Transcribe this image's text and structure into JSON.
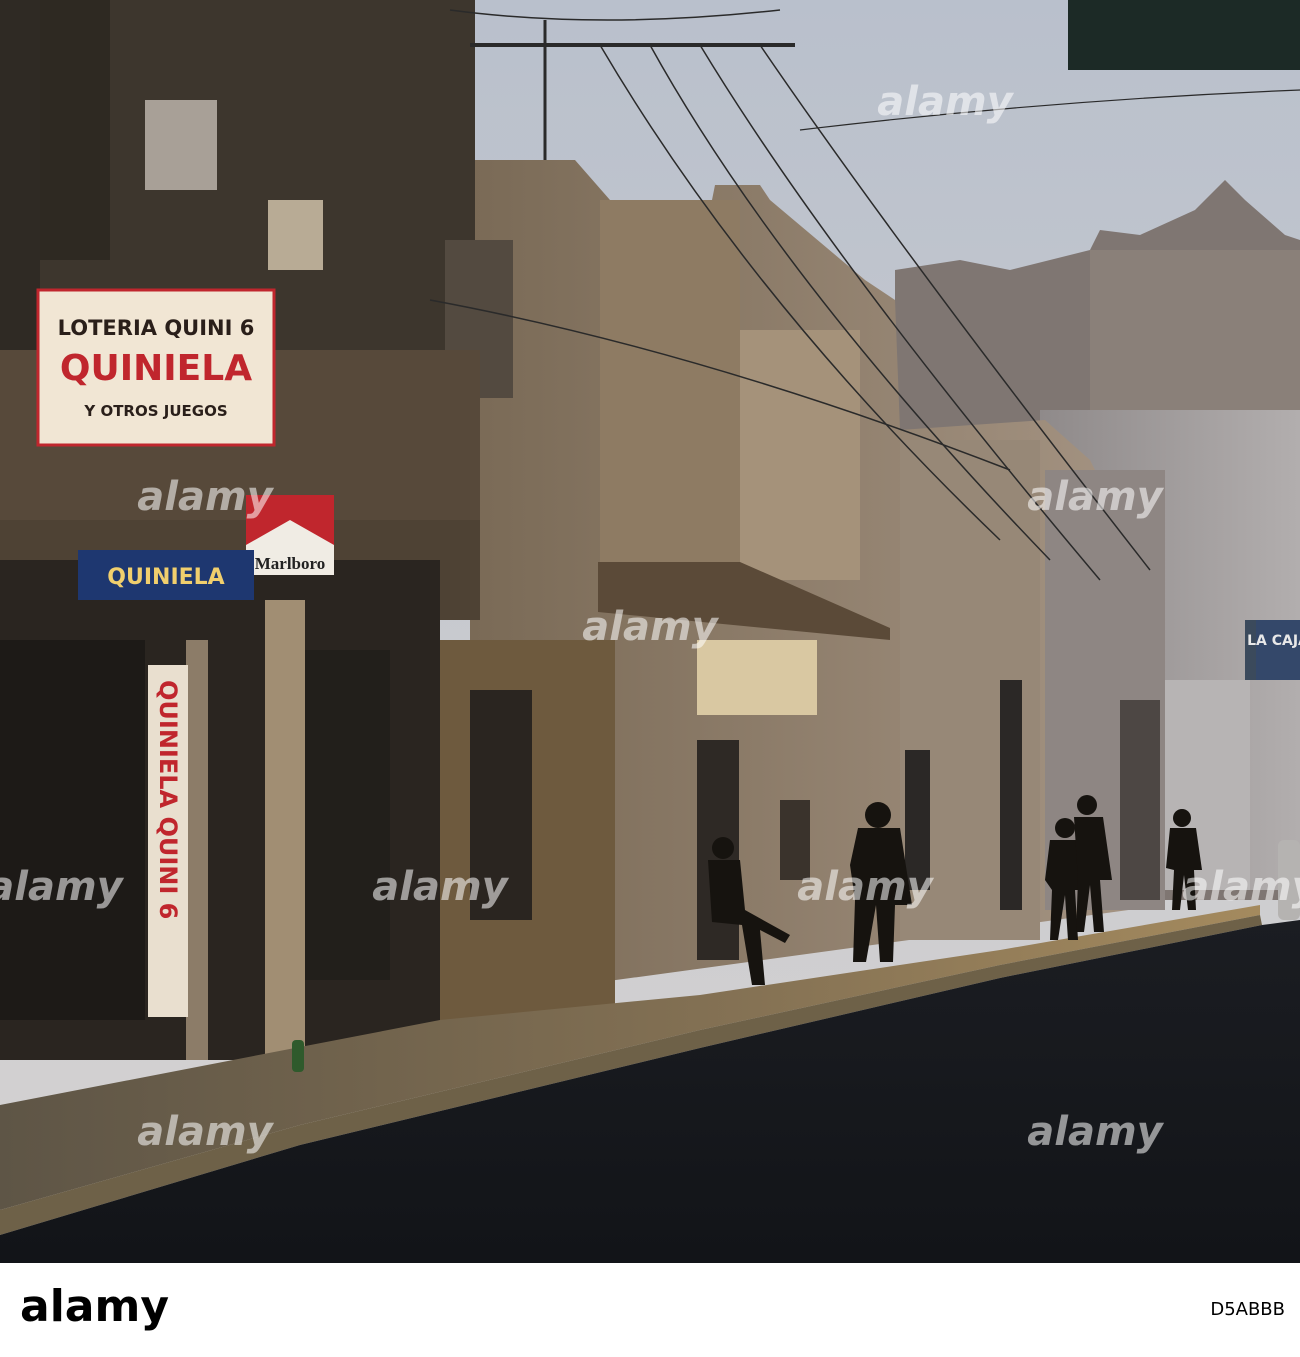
{
  "signs": {
    "loteria_line1": "LOTERIA QUINI 6",
    "loteria_line2": "QUINIELA",
    "loteria_line3": "Y OTROS JUEGOS",
    "quiniela_blue": "QUINIELA",
    "marlboro": "Marlboro",
    "vertical_quiniela": "QUINIELA QUINI 6",
    "la_caja": "LA CAJA"
  },
  "watermark": {
    "text": "alamy"
  },
  "footer": {
    "brand": "alamy",
    "image_id": "D5ABBB"
  },
  "colors": {
    "sky": "#c8cbd2",
    "sign_red": "#c0262d",
    "sign_blue": "#1e3770",
    "footer_bg": "#ffffff",
    "footer_text": "#000000"
  }
}
